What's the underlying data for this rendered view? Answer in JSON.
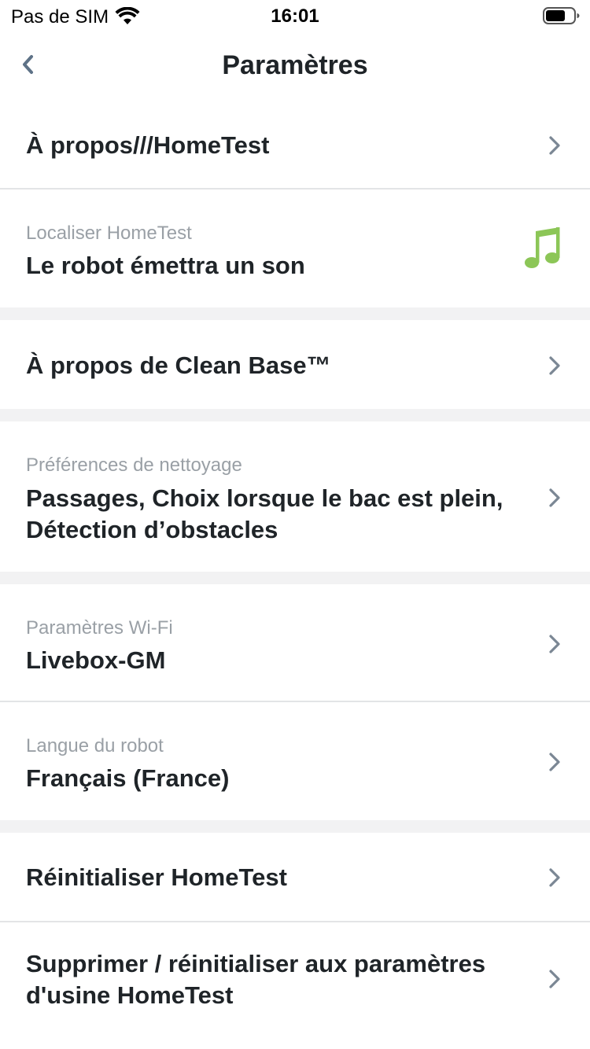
{
  "status_bar": {
    "carrier": "Pas de SIM",
    "time": "16:01",
    "icons": [
      "wifi-icon",
      "battery-icon"
    ]
  },
  "nav": {
    "title": "Paramètres",
    "back_icon": "chevron-left-icon"
  },
  "colors": {
    "accent_green": "#8cc657",
    "chevron": "#7b8794",
    "back": "#5e7287"
  },
  "rows": [
    {
      "title": "À propos///HomeTest",
      "icon": "chevron-right-icon"
    },
    {
      "subtitle": "Localiser HomeTest",
      "title": "Le robot émettra un son",
      "icon": "music-note-icon"
    },
    {
      "title": "À propos de Clean Base™",
      "icon": "chevron-right-icon"
    },
    {
      "subtitle": "Préférences de nettoyage",
      "title": "Passages, Choix lorsque le bac est plein, Détection d’obstacles",
      "icon": "chevron-right-icon"
    },
    {
      "subtitle": "Paramètres Wi-Fi",
      "title": "Livebox-GM",
      "icon": "chevron-right-icon"
    },
    {
      "subtitle": "Langue du robot",
      "title": "Français (France)",
      "icon": "chevron-right-icon"
    },
    {
      "title": "Réinitialiser HomeTest",
      "icon": "chevron-right-icon"
    },
    {
      "title": "Supprimer / réinitialiser aux paramètres d'usine HomeTest",
      "icon": "chevron-right-icon"
    }
  ]
}
